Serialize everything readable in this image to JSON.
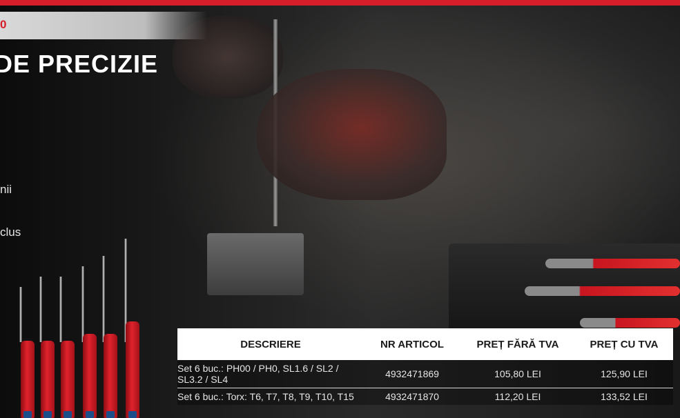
{
  "banner": {
    "code": "0"
  },
  "title": "DE PRECIZIE",
  "body_lines": [
    "nii",
    "clus"
  ],
  "table": {
    "headers": [
      "DESCRIERE",
      "NR ARTICOL",
      "PREȚ FĂRĂ TVA",
      "PREȚ CU TVA"
    ],
    "rows": [
      {
        "description": "Set 6 buc.: PH00 / PH0, SL1.6 / SL2 / SL3.2 / SL4",
        "article": "4932471869",
        "price_net": "105,80 LEI",
        "price_gross": "125,90 LEI"
      },
      {
        "description": "Set 6 buc.: Torx: T6, T7, T8, T9, T10, T15",
        "article": "4932471870",
        "price_net": "112,20 LEI",
        "price_gross": "133,52 LEI"
      }
    ]
  },
  "colors": {
    "brand_red": "#d51e2a",
    "banner_gray": "#d9d9d9",
    "table_header_bg": "#ffffff"
  },
  "icons": {
    "tools": "precision-screwdriver-icon"
  }
}
